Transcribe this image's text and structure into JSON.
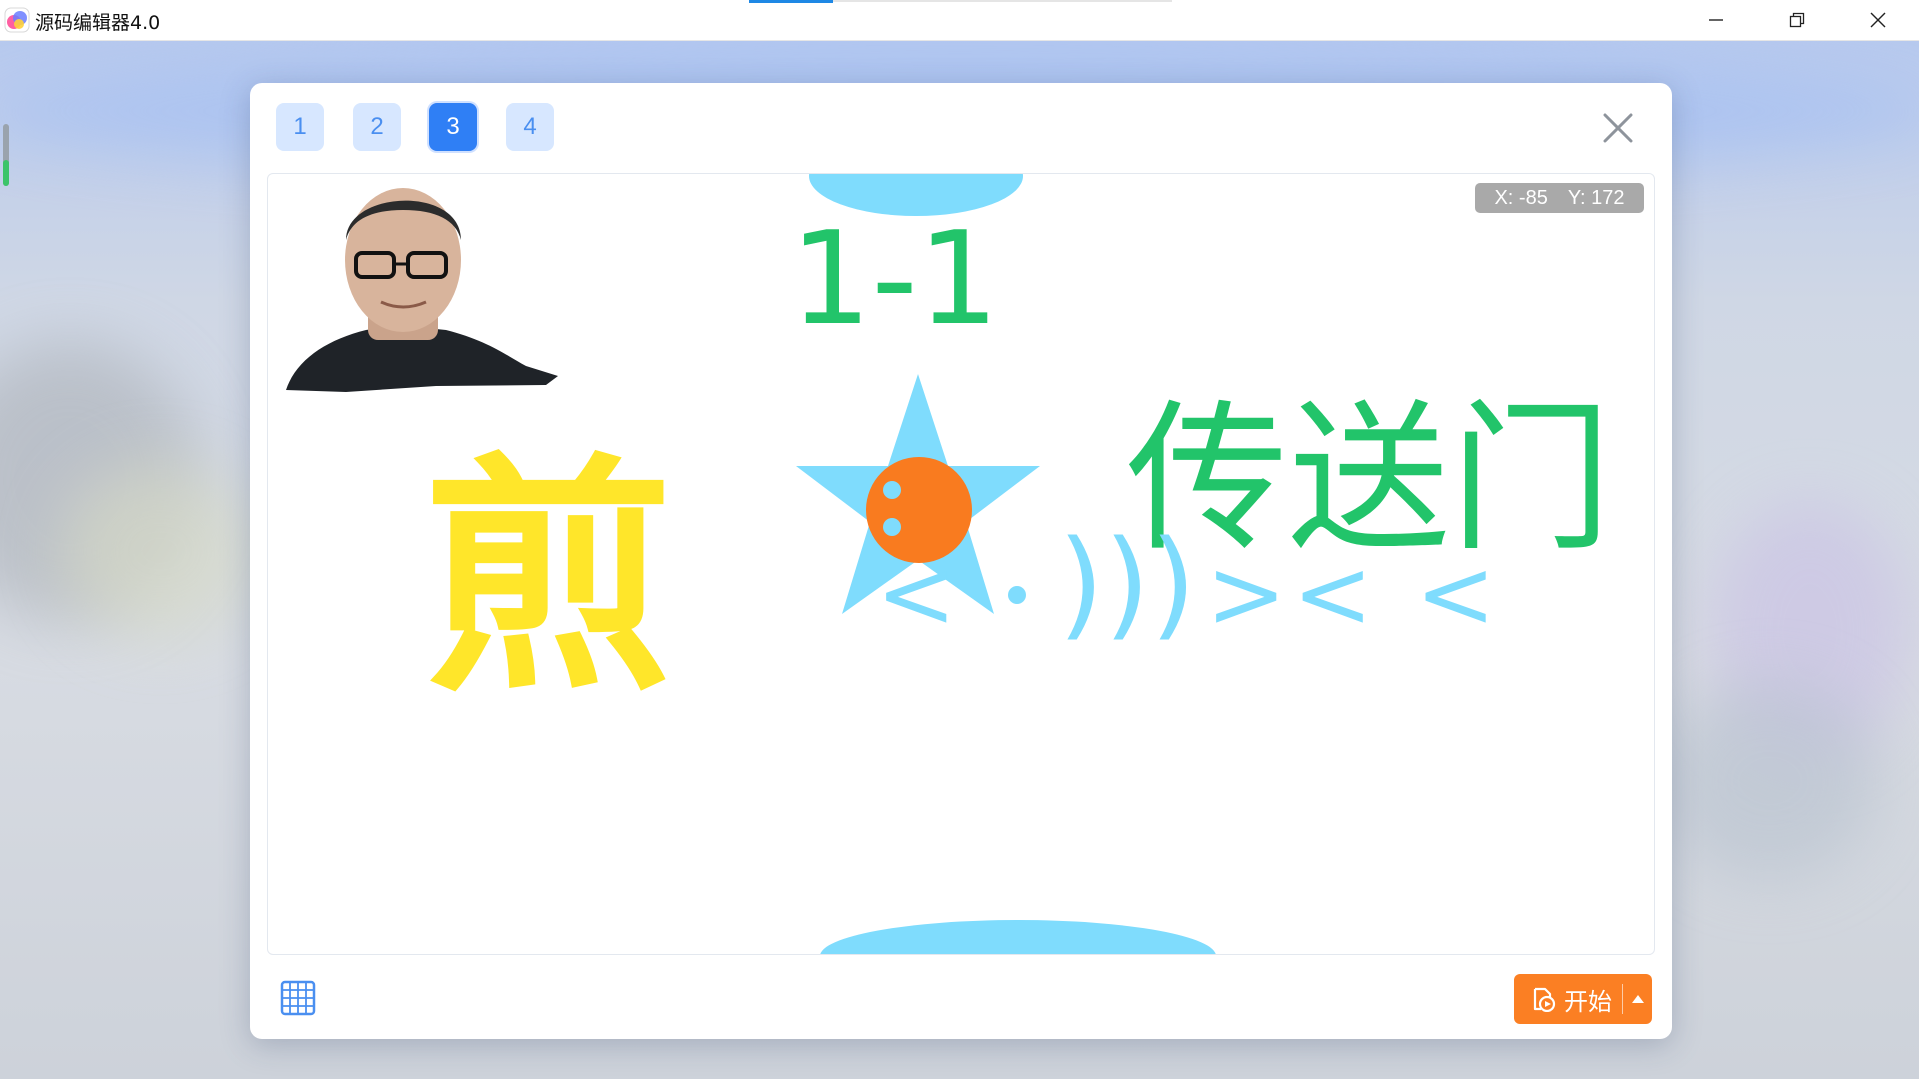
{
  "window": {
    "title": "源码编辑器4.0",
    "icon": "app-logo-icon",
    "controls": [
      "minimize-icon",
      "restore-icon",
      "close-icon"
    ]
  },
  "dialog": {
    "scene_tabs": [
      {
        "label": "1",
        "active": false
      },
      {
        "label": "2",
        "active": false
      },
      {
        "label": "3",
        "active": true
      },
      {
        "label": "4",
        "active": false
      }
    ],
    "close_icon": "close-icon",
    "stage": {
      "coords": {
        "x_label": "X: -85",
        "y_label": "Y: 172"
      },
      "level_text": "1-1",
      "portal_text": "传送门",
      "fry_text": "煎",
      "arrows_text": ">< <",
      "waves_text": ")))",
      "left_arrow_text": "<",
      "colors": {
        "green": "#22c46a",
        "yellow": "#ffe62a",
        "light_blue": "#7fdcfd",
        "orange": "#f97b1f"
      }
    },
    "grid_icon": "grid-icon",
    "start_button": {
      "label": "开始",
      "icon": "play-file-icon",
      "dropdown_icon": "caret-up-icon"
    }
  },
  "accent_colors": {
    "tab_active": "#2f7ff5",
    "tab_inactive_bg": "#d7e7ff",
    "start_button": "#fb7f23"
  }
}
